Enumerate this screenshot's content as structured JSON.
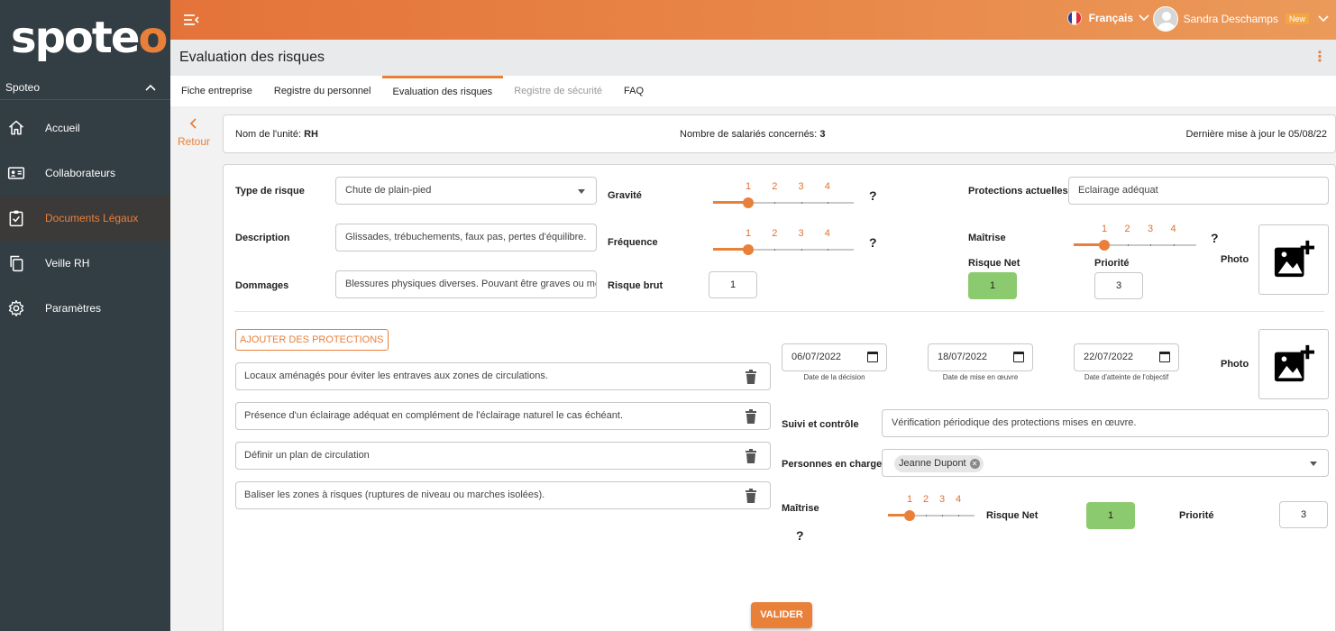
{
  "brand": {
    "logo_text_a": "spote",
    "logo_text_b": "o",
    "accent": "#e8803a",
    "sidebar_bg": "#333d44"
  },
  "sidebar": {
    "org_name": "Spoteo",
    "items": [
      {
        "label": "Accueil",
        "icon": "home-icon",
        "active": false
      },
      {
        "label": "Collaborateurs",
        "icon": "id-card-icon",
        "active": false
      },
      {
        "label": "Documents Légaux",
        "icon": "clipboard-check-icon",
        "active": true
      },
      {
        "label": "Veille RH",
        "icon": "copy-icon",
        "active": false
      },
      {
        "label": "Paramètres",
        "icon": "gear-icon",
        "active": false
      }
    ]
  },
  "topbar": {
    "language": "Français",
    "user_name": "Sandra Deschamps",
    "user_badge": "New"
  },
  "page": {
    "title": "Evaluation des risques"
  },
  "tabs": [
    {
      "label": "Fiche entreprise",
      "state": "normal"
    },
    {
      "label": "Registre du personnel",
      "state": "normal"
    },
    {
      "label": "Evaluation des risques",
      "state": "active"
    },
    {
      "label": "Registre de sécurité",
      "state": "disabled"
    },
    {
      "label": "FAQ",
      "state": "normal"
    }
  ],
  "back_label": "Retour",
  "info": {
    "unit_label": "Nom de l'unité:",
    "unit_value": "RH",
    "employees_label": "Nombre de salariés concernés:",
    "employees_value": "3",
    "updated_text": "Dernière mise à jour le 05/08/22"
  },
  "risk": {
    "type_label": "Type de risque",
    "type_value": "Chute de plain-pied",
    "description_label": "Description",
    "description_value": "Glissades, trébuchements, faux pas, pertes d'équilibre.",
    "dommages_label": "Dommages",
    "dommages_value": "Blessures physiques diverses. Pouvant être graves ou mortelles.",
    "gravite_label": "Gravité",
    "gravite_value": 1,
    "frequence_label": "Fréquence",
    "frequence_value": 1,
    "risque_brut_label": "Risque brut",
    "risque_brut_value": "1",
    "scale": [
      "1",
      "2",
      "3",
      "4"
    ],
    "help_mark": "?",
    "protections_label": "Protections actuelles",
    "protections_value": "Eclairage adéquat",
    "maitrise_label": "Maîtrise",
    "maitrise_value": 1,
    "risque_net_label": "Risque Net",
    "risque_net_value": "1",
    "priorite_label": "Priorité",
    "priorite_value": "3",
    "photo_label": "Photo"
  },
  "actions": {
    "add_button": "AJOUTER DES PROTECTIONS",
    "protections": [
      "Locaux aménagés pour éviter les entraves aux zones de circulations.",
      "Présence d'un éclairage adéquat en complément de l'éclairage naturel le cas échéant.",
      "Définir un plan de circulation",
      "Baliser les zones à risques (ruptures de niveau ou marches isolées)."
    ],
    "dates": [
      {
        "value": "06/07/2022",
        "caption": "Date de la décision"
      },
      {
        "value": "18/07/2022",
        "caption": "Date de mise en œuvre"
      },
      {
        "value": "22/07/2022",
        "caption": "Date d'atteinte de l'objectif"
      }
    ],
    "photo_label": "Photo",
    "suivi_label": "Suivi et contrôle",
    "suivi_value": "Vérification périodique des protections mises en œuvre.",
    "personnes_label": "Personnes en charge",
    "personnes_chip": "Jeanne Dupont",
    "maitrise_label": "Maîtrise",
    "maitrise_value": 1,
    "risque_net_label": "Risque Net",
    "risque_net_value": "1",
    "priorite_label": "Priorité",
    "priorite_value": "3",
    "help_mark": "?"
  },
  "submit_label": "VALIDER"
}
